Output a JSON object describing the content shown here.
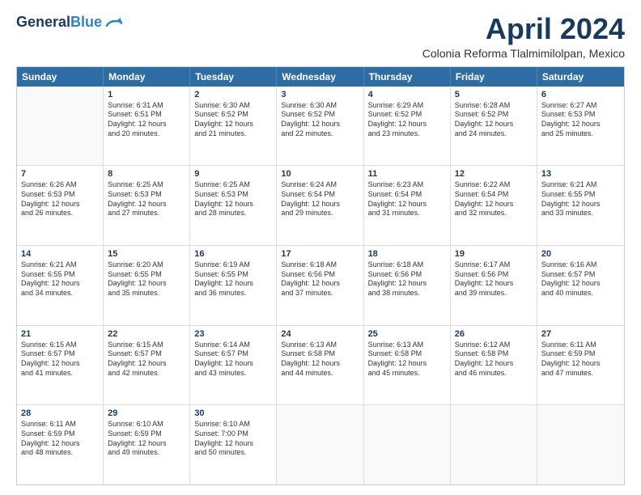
{
  "header": {
    "logo_line1": "General",
    "logo_line2": "Blue",
    "month": "April 2024",
    "location": "Colonia Reforma Tlalmimilolpan, Mexico"
  },
  "days_of_week": [
    "Sunday",
    "Monday",
    "Tuesday",
    "Wednesday",
    "Thursday",
    "Friday",
    "Saturday"
  ],
  "weeks": [
    [
      {
        "day": "",
        "lines": []
      },
      {
        "day": "1",
        "lines": [
          "Sunrise: 6:31 AM",
          "Sunset: 6:51 PM",
          "Daylight: 12 hours",
          "and 20 minutes."
        ]
      },
      {
        "day": "2",
        "lines": [
          "Sunrise: 6:30 AM",
          "Sunset: 6:52 PM",
          "Daylight: 12 hours",
          "and 21 minutes."
        ]
      },
      {
        "day": "3",
        "lines": [
          "Sunrise: 6:30 AM",
          "Sunset: 6:52 PM",
          "Daylight: 12 hours",
          "and 22 minutes."
        ]
      },
      {
        "day": "4",
        "lines": [
          "Sunrise: 6:29 AM",
          "Sunset: 6:52 PM",
          "Daylight: 12 hours",
          "and 23 minutes."
        ]
      },
      {
        "day": "5",
        "lines": [
          "Sunrise: 6:28 AM",
          "Sunset: 6:52 PM",
          "Daylight: 12 hours",
          "and 24 minutes."
        ]
      },
      {
        "day": "6",
        "lines": [
          "Sunrise: 6:27 AM",
          "Sunset: 6:53 PM",
          "Daylight: 12 hours",
          "and 25 minutes."
        ]
      }
    ],
    [
      {
        "day": "7",
        "lines": [
          "Sunrise: 6:26 AM",
          "Sunset: 6:53 PM",
          "Daylight: 12 hours",
          "and 26 minutes."
        ]
      },
      {
        "day": "8",
        "lines": [
          "Sunrise: 6:25 AM",
          "Sunset: 6:53 PM",
          "Daylight: 12 hours",
          "and 27 minutes."
        ]
      },
      {
        "day": "9",
        "lines": [
          "Sunrise: 6:25 AM",
          "Sunset: 6:53 PM",
          "Daylight: 12 hours",
          "and 28 minutes."
        ]
      },
      {
        "day": "10",
        "lines": [
          "Sunrise: 6:24 AM",
          "Sunset: 6:54 PM",
          "Daylight: 12 hours",
          "and 29 minutes."
        ]
      },
      {
        "day": "11",
        "lines": [
          "Sunrise: 6:23 AM",
          "Sunset: 6:54 PM",
          "Daylight: 12 hours",
          "and 31 minutes."
        ]
      },
      {
        "day": "12",
        "lines": [
          "Sunrise: 6:22 AM",
          "Sunset: 6:54 PM",
          "Daylight: 12 hours",
          "and 32 minutes."
        ]
      },
      {
        "day": "13",
        "lines": [
          "Sunrise: 6:21 AM",
          "Sunset: 6:55 PM",
          "Daylight: 12 hours",
          "and 33 minutes."
        ]
      }
    ],
    [
      {
        "day": "14",
        "lines": [
          "Sunrise: 6:21 AM",
          "Sunset: 6:55 PM",
          "Daylight: 12 hours",
          "and 34 minutes."
        ]
      },
      {
        "day": "15",
        "lines": [
          "Sunrise: 6:20 AM",
          "Sunset: 6:55 PM",
          "Daylight: 12 hours",
          "and 35 minutes."
        ]
      },
      {
        "day": "16",
        "lines": [
          "Sunrise: 6:19 AM",
          "Sunset: 6:55 PM",
          "Daylight: 12 hours",
          "and 36 minutes."
        ]
      },
      {
        "day": "17",
        "lines": [
          "Sunrise: 6:18 AM",
          "Sunset: 6:56 PM",
          "Daylight: 12 hours",
          "and 37 minutes."
        ]
      },
      {
        "day": "18",
        "lines": [
          "Sunrise: 6:18 AM",
          "Sunset: 6:56 PM",
          "Daylight: 12 hours",
          "and 38 minutes."
        ]
      },
      {
        "day": "19",
        "lines": [
          "Sunrise: 6:17 AM",
          "Sunset: 6:56 PM",
          "Daylight: 12 hours",
          "and 39 minutes."
        ]
      },
      {
        "day": "20",
        "lines": [
          "Sunrise: 6:16 AM",
          "Sunset: 6:57 PM",
          "Daylight: 12 hours",
          "and 40 minutes."
        ]
      }
    ],
    [
      {
        "day": "21",
        "lines": [
          "Sunrise: 6:15 AM",
          "Sunset: 6:57 PM",
          "Daylight: 12 hours",
          "and 41 minutes."
        ]
      },
      {
        "day": "22",
        "lines": [
          "Sunrise: 6:15 AM",
          "Sunset: 6:57 PM",
          "Daylight: 12 hours",
          "and 42 minutes."
        ]
      },
      {
        "day": "23",
        "lines": [
          "Sunrise: 6:14 AM",
          "Sunset: 6:57 PM",
          "Daylight: 12 hours",
          "and 43 minutes."
        ]
      },
      {
        "day": "24",
        "lines": [
          "Sunrise: 6:13 AM",
          "Sunset: 6:58 PM",
          "Daylight: 12 hours",
          "and 44 minutes."
        ]
      },
      {
        "day": "25",
        "lines": [
          "Sunrise: 6:13 AM",
          "Sunset: 6:58 PM",
          "Daylight: 12 hours",
          "and 45 minutes."
        ]
      },
      {
        "day": "26",
        "lines": [
          "Sunrise: 6:12 AM",
          "Sunset: 6:58 PM",
          "Daylight: 12 hours",
          "and 46 minutes."
        ]
      },
      {
        "day": "27",
        "lines": [
          "Sunrise: 6:11 AM",
          "Sunset: 6:59 PM",
          "Daylight: 12 hours",
          "and 47 minutes."
        ]
      }
    ],
    [
      {
        "day": "28",
        "lines": [
          "Sunrise: 6:11 AM",
          "Sunset: 6:59 PM",
          "Daylight: 12 hours",
          "and 48 minutes."
        ]
      },
      {
        "day": "29",
        "lines": [
          "Sunrise: 6:10 AM",
          "Sunset: 6:59 PM",
          "Daylight: 12 hours",
          "and 49 minutes."
        ]
      },
      {
        "day": "30",
        "lines": [
          "Sunrise: 6:10 AM",
          "Sunset: 7:00 PM",
          "Daylight: 12 hours",
          "and 50 minutes."
        ]
      },
      {
        "day": "",
        "lines": []
      },
      {
        "day": "",
        "lines": []
      },
      {
        "day": "",
        "lines": []
      },
      {
        "day": "",
        "lines": []
      }
    ]
  ]
}
